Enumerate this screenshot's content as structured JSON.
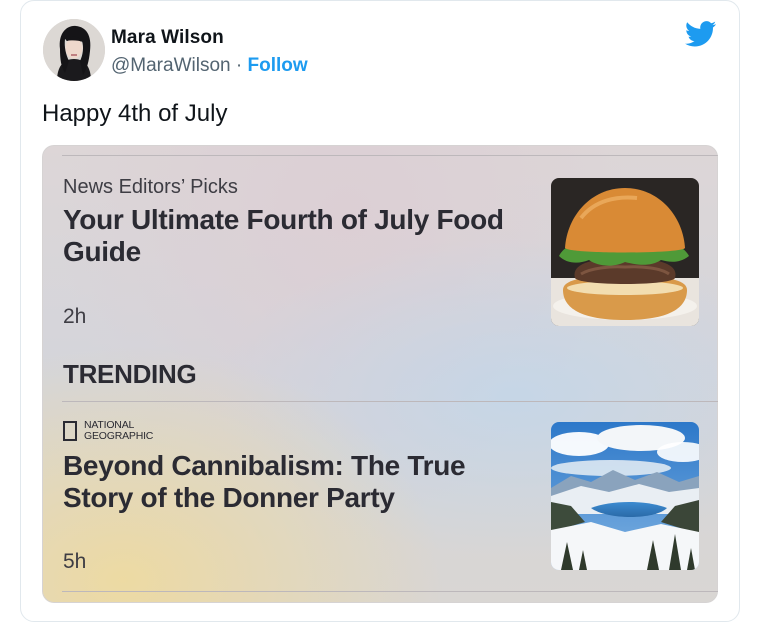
{
  "tweet": {
    "author_name": "Mara Wilson",
    "handle": "@MaraWilson",
    "separator": "·",
    "follow_label": "Follow",
    "text": "Happy 4th of July",
    "brand_color": "#1d9bf0",
    "logo_icon": "twitter-bird-icon"
  },
  "news_card": {
    "top_story": {
      "source": "News Editors’ Picks",
      "title": "Your Ultimate Fourth of July Food Guide",
      "time": "2h",
      "thumbnail": "burger-photo"
    },
    "trending_label": "TRENDING",
    "trending_story": {
      "source_line1": "National",
      "source_line2": "Geographic",
      "title": "Beyond Cannibalism: The True Story of the Donner Party",
      "time": "5h",
      "thumbnail": "mountain-lake-photo"
    }
  }
}
